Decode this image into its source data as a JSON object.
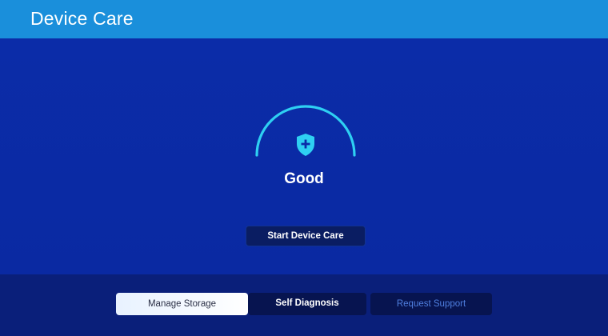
{
  "header": {
    "title": "Device Care"
  },
  "status": {
    "label": "Good",
    "icon": "shield-plus-icon",
    "gauge_color": "#2ed0f2"
  },
  "actions": {
    "start_label": "Start Device Care"
  },
  "tabs": [
    {
      "label": "Manage Storage",
      "selected": true
    },
    {
      "label": "Self Diagnosis",
      "selected": false
    },
    {
      "label": "Request Support",
      "selected": false
    }
  ],
  "colors": {
    "header_bg": "#1a8fdb",
    "main_bg": "#0b2ca8",
    "accent": "#2ed0f2",
    "tab_selected_bg": "#ffffff",
    "tab_bg": "#071450"
  }
}
